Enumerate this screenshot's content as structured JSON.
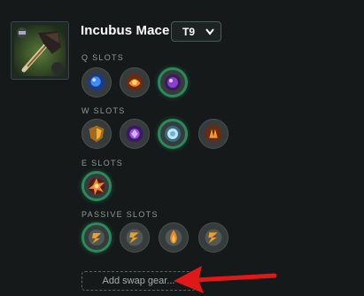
{
  "item": {
    "name": "Incubus Mace",
    "tier": "T9",
    "icon": "mace-icon"
  },
  "sections": {
    "q": {
      "label": "Q SLOTS"
    },
    "w": {
      "label": "W SLOTS"
    },
    "e": {
      "label": "E SLOTS"
    },
    "passive": {
      "label": "PASSIVE SLOTS"
    }
  },
  "swap": {
    "label": "Add swap gear..."
  },
  "colors": {
    "accent_green": "#2a8a5c",
    "arrow_red": "#e01818",
    "background": "#15191a"
  }
}
